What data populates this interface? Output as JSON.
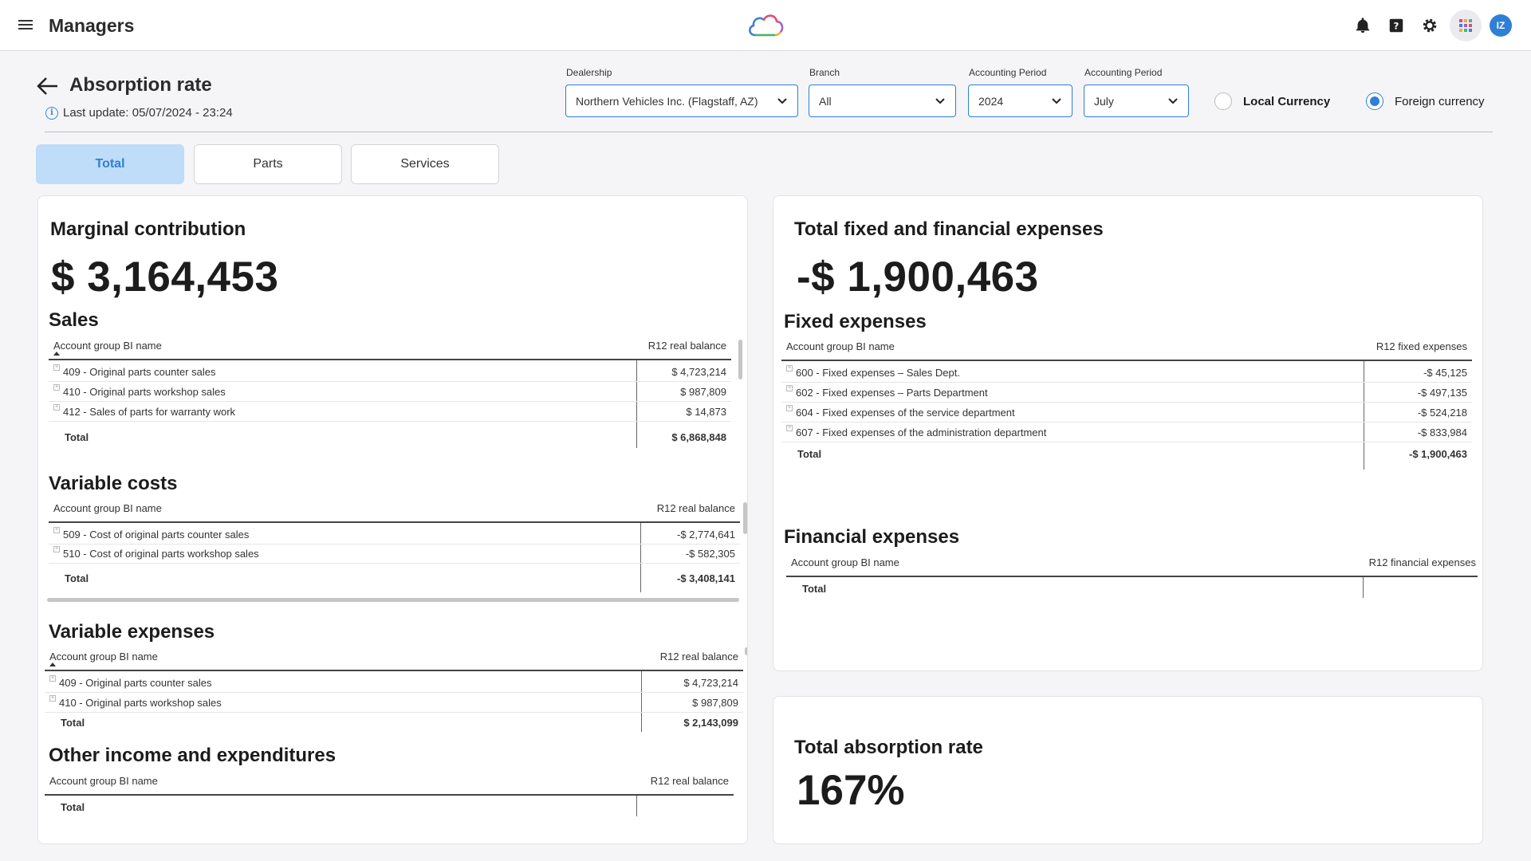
{
  "header": {
    "title": "Managers",
    "avatar_initials": "IZ"
  },
  "page": {
    "title": "Absorption rate",
    "last_update": "Last update: 05/07/2024 - 23:24"
  },
  "filters": {
    "dealership": {
      "label": "Dealership",
      "value": "Northern Vehicles Inc. (Flagstaff, AZ)"
    },
    "branch": {
      "label": "Branch",
      "value": "All"
    },
    "period_year": {
      "label": "Accounting Period",
      "value": "2024"
    },
    "period_month": {
      "label": "Accounting Period",
      "value": "July"
    },
    "currency": {
      "local": "Local Currency",
      "foreign": "Foreign currency",
      "selected": "foreign"
    }
  },
  "tabs": [
    {
      "label": "Total",
      "active": true
    },
    {
      "label": "Parts",
      "active": false
    },
    {
      "label": "Services",
      "active": false
    }
  ],
  "marginal": {
    "title": "Marginal contribution",
    "value": "$ 3,164,453",
    "sales": {
      "title": "Sales",
      "col1": "Account group BI name",
      "col2": "R12 real balance",
      "rows": [
        {
          "name": "409 - Original parts counter sales",
          "value": "$ 4,723,214"
        },
        {
          "name": "410 - Original parts workshop sales",
          "value": "$ 987,809"
        },
        {
          "name": "412 - Sales of parts for warranty work",
          "value": "$ 14,873"
        }
      ],
      "total_label": "Total",
      "total": "$ 6,868,848"
    },
    "variable_costs": {
      "title": "Variable costs",
      "col1": "Account group BI name",
      "col2": "R12 real balance",
      "rows": [
        {
          "name": "509 - Cost of original parts counter sales",
          "value": "-$ 2,774,641"
        },
        {
          "name": "510 - Cost of original parts workshop sales",
          "value": "-$ 582,305"
        }
      ],
      "total_label": "Total",
      "total": "-$ 3,408,141"
    },
    "variable_expenses": {
      "title": "Variable expenses",
      "col1": "Account group BI name",
      "col2": "R12 real balance",
      "rows": [
        {
          "name": "409 - Original parts counter sales",
          "value": "$ 4,723,214"
        },
        {
          "name": "410 - Original parts workshop sales",
          "value": "$ 987,809"
        }
      ],
      "total_label": "Total",
      "total": "$ 2,143,099"
    },
    "other": {
      "title": "Other income and expenditures",
      "col1": "Account group BI name",
      "col2": "R12 real balance",
      "total_label": "Total"
    }
  },
  "fixed_financial": {
    "title": "Total fixed and financial expenses",
    "value": "-$ 1,900,463",
    "fixed": {
      "title": "Fixed expenses",
      "col1": "Account group BI name",
      "col2": "R12 fixed expenses",
      "rows": [
        {
          "name": "600 - Fixed expenses – Sales Dept.",
          "value": "-$ 45,125"
        },
        {
          "name": "602 - Fixed expenses – Parts Department",
          "value": "-$ 497,135"
        },
        {
          "name": "604 - Fixed expenses of the service department",
          "value": "-$ 524,218"
        },
        {
          "name": "607 - Fixed expenses of the administration department",
          "value": "-$ 833,984"
        }
      ],
      "total_label": "Total",
      "total": "-$ 1,900,463"
    },
    "financial": {
      "title": "Financial expenses",
      "col1": "Account group BI name",
      "col2": "R12 financial expenses",
      "total_label": "Total"
    }
  },
  "absorption": {
    "title": "Total absorption rate",
    "value": "167%"
  }
}
